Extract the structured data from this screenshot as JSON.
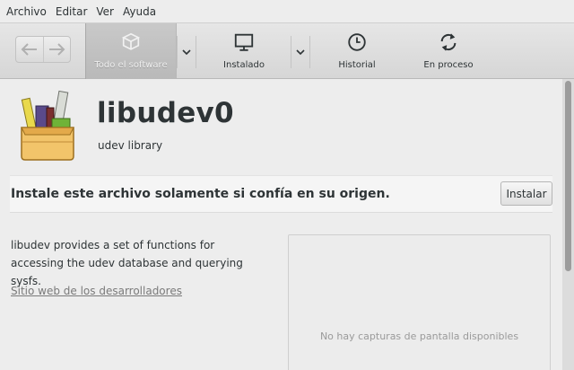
{
  "menubar": {
    "items": [
      {
        "label": "Archivo"
      },
      {
        "label": "Editar"
      },
      {
        "label": "Ver"
      },
      {
        "label": "Ayuda"
      }
    ]
  },
  "toolbar": {
    "back_icon": "back-arrow-icon",
    "forward_icon": "forward-arrow-icon",
    "all_software": {
      "label": "Todo el software",
      "icon": "package-icon",
      "active": true
    },
    "installed": {
      "label": "Instalado",
      "icon": "monitor-icon"
    },
    "history": {
      "label": "Historial",
      "icon": "clock-icon"
    },
    "in_progress": {
      "label": "En proceso",
      "icon": "refresh-icon"
    }
  },
  "app": {
    "name": "libudev0",
    "summary": "udev library",
    "icon": "package-box-icon"
  },
  "warning": {
    "text": "Instale este archivo solamente si confía en su origen.",
    "install_label": "Instalar"
  },
  "description": "libudev provides a set of functions for accessing the udev database and querying sysfs.",
  "developer_link": "Sitio web de los desarrolladores",
  "screenshots": {
    "empty_text": "No hay capturas de pantalla disponibles"
  },
  "colors": {
    "background": "#ededed",
    "text": "#2e3436",
    "active_tab": "#bfbfbf"
  }
}
